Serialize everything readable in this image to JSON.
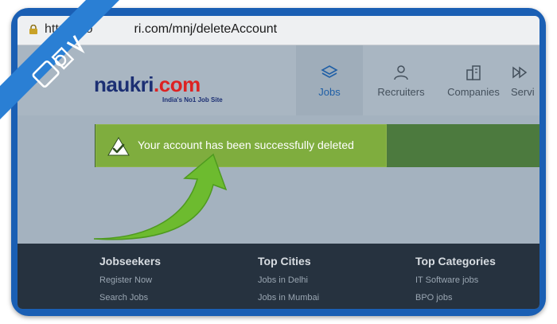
{
  "browser": {
    "url_prefix": "https://lo",
    "url_host": "ri.com/mnj/deleteAccount"
  },
  "logo": {
    "name": "naukri",
    "tld": ".com",
    "tagline": "India's No1 Job Site"
  },
  "nav": [
    {
      "label": "Jobs",
      "icon": "layers-icon",
      "active": true
    },
    {
      "label": "Recruiters",
      "icon": "people-icon",
      "active": false
    },
    {
      "label": "Companies",
      "icon": "building-icon",
      "active": false
    },
    {
      "label": "Servi",
      "icon": "forward-icon",
      "active": false
    }
  ],
  "alert": {
    "message": "Your account has been successfully deleted",
    "icon": "check-icon"
  },
  "footer": {
    "jobseekers": {
      "heading": "Jobseekers",
      "links": [
        "Register Now",
        "Search Jobs"
      ]
    },
    "cities": {
      "heading": "Top Cities",
      "links": [
        "Jobs in Delhi",
        "Jobs in Mumbai"
      ]
    },
    "categories": {
      "heading": "Top Categories",
      "links": [
        "IT Software jobs",
        "BPO jobs"
      ]
    }
  },
  "colors": {
    "frame": "#1a5fb4",
    "alert_light": "#7fad3e",
    "alert_dark": "#4c7a3e",
    "arrow": "#6dbb2f"
  }
}
